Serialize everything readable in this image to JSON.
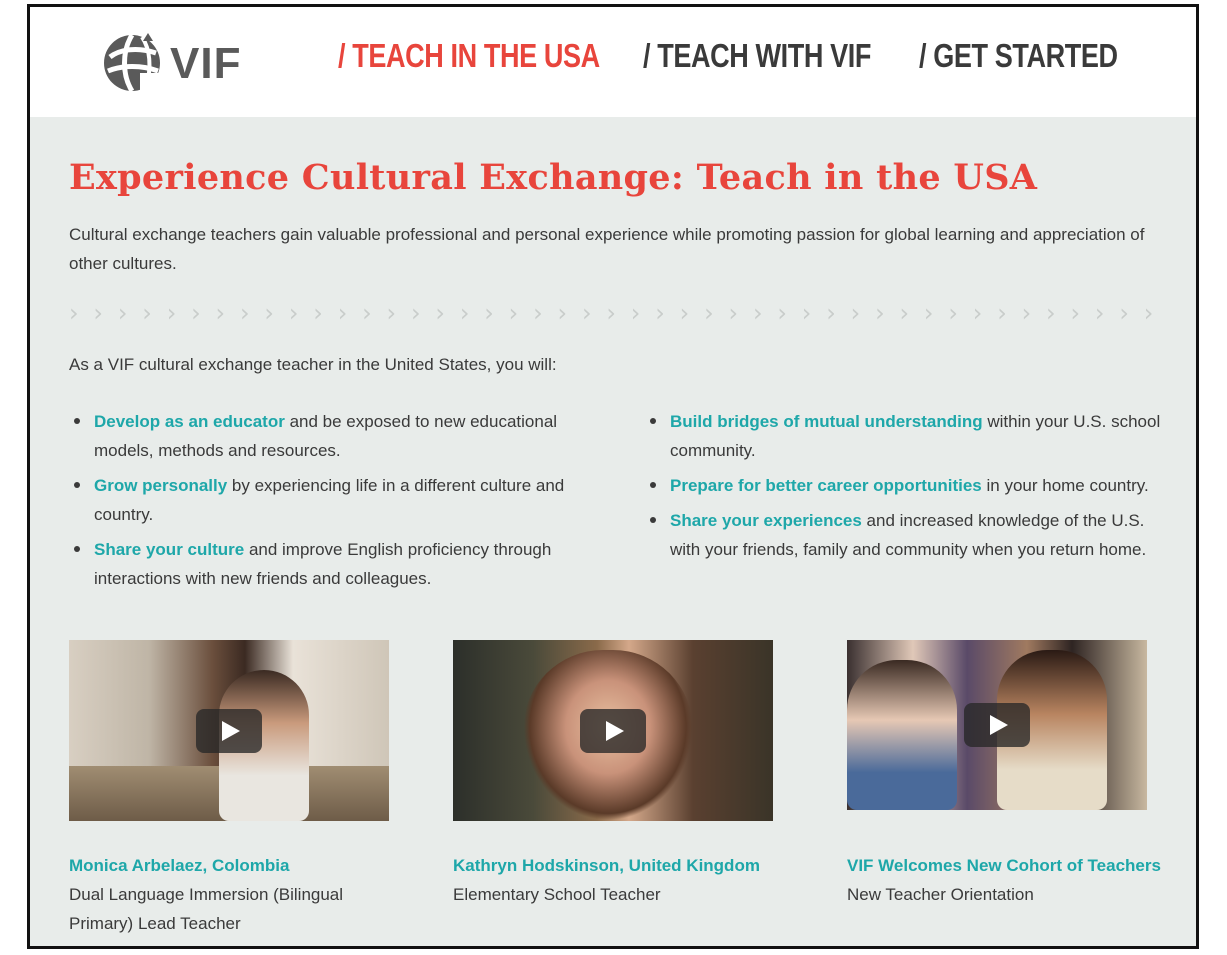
{
  "header": {
    "logo_text": "VIF",
    "nav": [
      {
        "label": "/ TEACH IN THE USA",
        "active": true
      },
      {
        "label": "/ TEACH WITH VIF",
        "active": false
      },
      {
        "label": "/ GET STARTED",
        "active": false
      }
    ]
  },
  "main": {
    "title": "Experience Cultural Exchange: Teach in the USA",
    "intro": "Cultural exchange teachers gain valuable professional and personal experience while promoting passion for global learning and appreciation of other cultures.",
    "divider": "› › › › › › › › › › › › › › › › › › › › › › › › › › › › › › › › › › › › › › › › › › › › › › › › › › › ›",
    "lead": "As a VIF cultural exchange teacher in the United States, you will:",
    "left_items": [
      {
        "highlight": "Develop as an educator",
        "rest": " and be exposed to new educational models, methods and resources."
      },
      {
        "highlight": "Grow personally",
        "rest": " by experiencing life in a different culture and country."
      },
      {
        "highlight": "Share your culture",
        "rest": " and improve English proficiency through interactions with new friends and colleagues."
      }
    ],
    "right_items": [
      {
        "highlight": "Build bridges of mutual understanding",
        "rest": " within your U.S. school community."
      },
      {
        "highlight": "Prepare for better career opportunities",
        "rest": " in your home country."
      },
      {
        "highlight": "Share your experiences",
        "rest": " and increased knowledge of the U.S. with your friends, family and community when you return home."
      }
    ]
  },
  "videos": [
    {
      "title": "Monica Arbelaez, Colombia",
      "subtitle": "Dual Language Immersion (Bilingual Primary) Lead Teacher"
    },
    {
      "title": "Kathryn Hodskinson, United Kingdom",
      "subtitle": "Elementary School Teacher"
    },
    {
      "title": "VIF Welcomes New Cohort of Teachers",
      "subtitle": "New Teacher Orientation"
    }
  ],
  "colors": {
    "accent_red": "#e8453c",
    "link_teal": "#1ea7a9",
    "page_bg": "#e8ecea"
  }
}
